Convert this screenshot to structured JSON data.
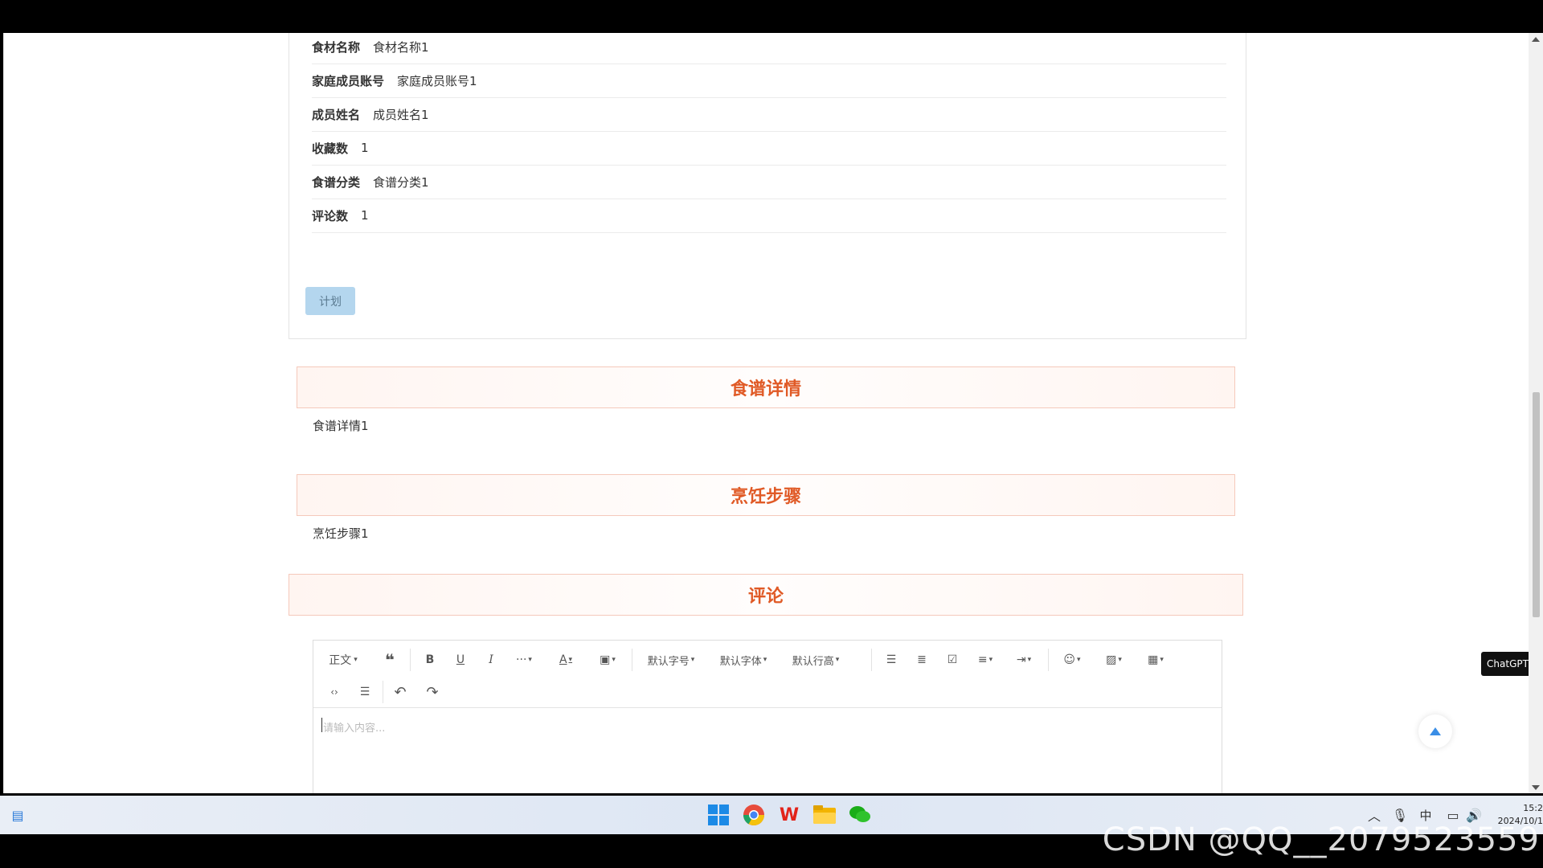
{
  "details": [
    {
      "label": "食材名称",
      "value": "食材名称1"
    },
    {
      "label": "家庭成员账号",
      "value": "家庭成员账号1"
    },
    {
      "label": "成员姓名",
      "value": "成员姓名1"
    },
    {
      "label": "收藏数",
      "value": "1"
    },
    {
      "label": "食谱分类",
      "value": "食谱分类1"
    },
    {
      "label": "评论数",
      "value": "1"
    }
  ],
  "plan_button": "计划",
  "sections": {
    "recipe_detail": {
      "title": "食谱详情",
      "text": "食谱详情1"
    },
    "cooking_steps": {
      "title": "烹饪步骤",
      "text": "烹饪步骤1"
    },
    "comments": {
      "title": "评论"
    }
  },
  "editor": {
    "heading_select": "正文",
    "font_size_select": "默认字号",
    "font_family_select": "默认字体",
    "line_height_select": "默认行高",
    "placeholder": "请输入内容..."
  },
  "chatgpt_badge": "ChatGPT",
  "taskbar": {
    "tray_ime": "中",
    "clock_time": "15:2",
    "clock_date": "2024/10/1"
  },
  "watermark": "CSDN @QQ__2079523559",
  "colors": {
    "section_title": "#e05a26",
    "plan_button_bg": "#b4d6ee",
    "accent": "#3a8ee6"
  }
}
